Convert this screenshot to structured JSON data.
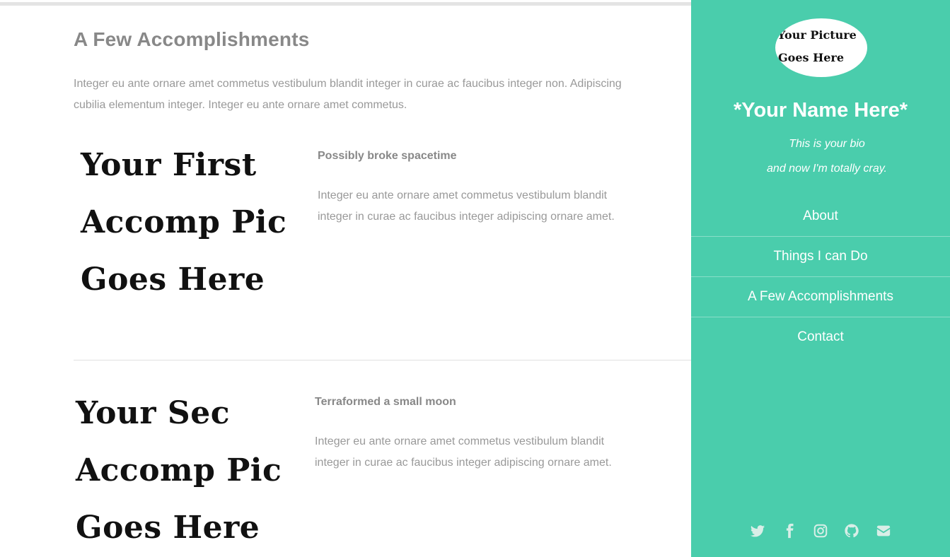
{
  "main": {
    "section_title": "A Few Accomplishments",
    "intro": "Integer eu ante ornare amet commetus vestibulum blandit integer in curae ac faucibus integer non. Adipiscing cubilia elementum integer. Integer eu ante ornare amet commetus.",
    "accomplishments": [
      {
        "pic_lines": [
          "Your First",
          "Accomp Pic",
          "Goes Here"
        ],
        "title": "Possibly broke spacetime",
        "text": "Integer eu ante ornare amet commetus vestibulum blandit integer in curae ac faucibus integer adipiscing ornare amet."
      },
      {
        "pic_lines": [
          "Your Sec",
          "Accomp Pic",
          "Goes Here"
        ],
        "title": "Terraformed a small moon",
        "text": "Integer eu ante ornare amet commetus vestibulum blandit integer in curae ac faucibus integer adipiscing ornare amet."
      }
    ]
  },
  "sidebar": {
    "avatar_lines": [
      "Your Picture",
      "Goes Here"
    ],
    "name": "*Your Name Here*",
    "bio_lines": [
      "This is your bio",
      "and now I'm totally cray."
    ],
    "nav": [
      {
        "label": "About"
      },
      {
        "label": "Things I can Do"
      },
      {
        "label": "A Few Accomplishments"
      },
      {
        "label": "Contact"
      }
    ],
    "social_icons": [
      "twitter-icon",
      "facebook-icon",
      "instagram-icon",
      "github-icon",
      "envelope-icon"
    ],
    "colors": {
      "background": "#4acdac",
      "text": "#ffffff",
      "icon": "#d8eee7"
    }
  }
}
